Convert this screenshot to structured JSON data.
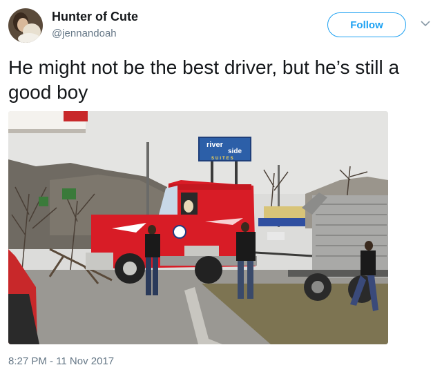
{
  "user": {
    "display_name": "Hunter of Cute",
    "handle": "@jennandoah"
  },
  "follow_button": {
    "label": "Follow"
  },
  "tweet": {
    "text": "He might not be the best driver, but he’s still a good boy",
    "timestamp": "8:27 PM - 11 Nov 2017"
  },
  "photo": {
    "hotel_sign_line1": "river",
    "hotel_sign_line2": "side",
    "hotel_sign_line3": "SUITES"
  },
  "colors": {
    "accent": "#1da1f2",
    "text_primary": "#14171a",
    "text_secondary": "#657786",
    "truck_red": "#d81c26"
  },
  "icons": {
    "dropdown": "chevron-down-icon"
  }
}
